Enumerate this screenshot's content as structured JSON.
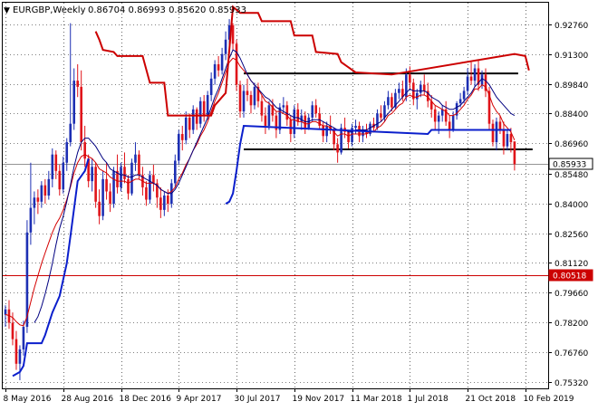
{
  "header": {
    "symbol": "EURGBP,Weekly",
    "ohlc": "0.86704 0.86993 0.85620 0.85933"
  },
  "price_badges": {
    "current": "0.85933",
    "level": "0.80518"
  },
  "colors": {
    "bull": "#1d2fb3",
    "bear": "#e0141a",
    "ma_fast": "#d40000",
    "ma_slow": "#000080",
    "stop_up": "#0b1fcc",
    "stop_down": "#cc0000",
    "hline": "#000000",
    "level": "#cc0000",
    "grid": "#000000",
    "frame": "#000000"
  },
  "chart_data": {
    "type": "candlestick",
    "title": "EURGBP,Weekly",
    "ylim": [
      0.75,
      0.938
    ],
    "y_ticks": [
      "0.92760",
      "0.91300",
      "0.89840",
      "0.88400",
      "0.86960",
      "0.85480",
      "0.84000",
      "0.82560",
      "0.81120",
      "0.79660",
      "0.78200",
      "0.76760",
      "0.75320"
    ],
    "x_ticks": [
      "8 May 2016",
      "28 Aug 2016",
      "18 Dec 2016",
      "9 Apr 2017",
      "30 Jul 2017",
      "19 Nov 2017",
      "11 Mar 2018",
      "1 Jul 2018",
      "21 Oct 2018",
      "10 Feb 2019"
    ],
    "x_tick_bar_index": [
      0,
      16,
      32,
      48,
      64,
      80,
      96,
      112,
      128,
      144
    ],
    "grid": true,
    "hlines": [
      {
        "value": 0.9035,
        "from_bar": 66,
        "to_bar": 142
      },
      {
        "value": 0.8665,
        "from_bar": 66,
        "to_bar": 146
      }
    ],
    "level_line": 0.80518,
    "current_price": 0.85933,
    "ohlc": [
      [
        0.7859,
        0.7905,
        0.78,
        0.7885
      ],
      [
        0.7885,
        0.793,
        0.779,
        0.782
      ],
      [
        0.782,
        0.787,
        0.771,
        0.774
      ],
      [
        0.774,
        0.778,
        0.759,
        0.762
      ],
      [
        0.762,
        0.771,
        0.754,
        0.769
      ],
      [
        0.769,
        0.783,
        0.766,
        0.78
      ],
      [
        0.78,
        0.832,
        0.777,
        0.826
      ],
      [
        0.826,
        0.86,
        0.82,
        0.838
      ],
      [
        0.838,
        0.846,
        0.83,
        0.843
      ],
      [
        0.843,
        0.847,
        0.835,
        0.841
      ],
      [
        0.841,
        0.851,
        0.838,
        0.849
      ],
      [
        0.849,
        0.852,
        0.84,
        0.844
      ],
      [
        0.844,
        0.856,
        0.842,
        0.852
      ],
      [
        0.852,
        0.867,
        0.848,
        0.864
      ],
      [
        0.864,
        0.866,
        0.852,
        0.856
      ],
      [
        0.856,
        0.859,
        0.844,
        0.847
      ],
      [
        0.847,
        0.863,
        0.845,
        0.86
      ],
      [
        0.86,
        0.872,
        0.856,
        0.87
      ],
      [
        0.87,
        0.928,
        0.868,
        0.879
      ],
      [
        0.879,
        0.906,
        0.876,
        0.9
      ],
      [
        0.9,
        0.908,
        0.892,
        0.897
      ],
      [
        0.897,
        0.905,
        0.866,
        0.87
      ],
      [
        0.87,
        0.878,
        0.858,
        0.862
      ],
      [
        0.862,
        0.864,
        0.848,
        0.851
      ],
      [
        0.851,
        0.862,
        0.846,
        0.858
      ],
      [
        0.858,
        0.86,
        0.838,
        0.841
      ],
      [
        0.841,
        0.847,
        0.83,
        0.834
      ],
      [
        0.834,
        0.856,
        0.832,
        0.852
      ],
      [
        0.852,
        0.86,
        0.842,
        0.846
      ],
      [
        0.846,
        0.85,
        0.836,
        0.84
      ],
      [
        0.84,
        0.858,
        0.838,
        0.856
      ],
      [
        0.856,
        0.864,
        0.845,
        0.848
      ],
      [
        0.848,
        0.86,
        0.846,
        0.858
      ],
      [
        0.858,
        0.865,
        0.85,
        0.852
      ],
      [
        0.852,
        0.854,
        0.842,
        0.845
      ],
      [
        0.845,
        0.862,
        0.844,
        0.86
      ],
      [
        0.86,
        0.87,
        0.856,
        0.864
      ],
      [
        0.864,
        0.866,
        0.852,
        0.854
      ],
      [
        0.854,
        0.858,
        0.844,
        0.848
      ],
      [
        0.848,
        0.851,
        0.839,
        0.842
      ],
      [
        0.842,
        0.856,
        0.84,
        0.854
      ],
      [
        0.854,
        0.859,
        0.846,
        0.85
      ],
      [
        0.85,
        0.852,
        0.838,
        0.843
      ],
      [
        0.843,
        0.848,
        0.833,
        0.837
      ],
      [
        0.837,
        0.846,
        0.834,
        0.844
      ],
      [
        0.844,
        0.847,
        0.836,
        0.84
      ],
      [
        0.84,
        0.852,
        0.838,
        0.85
      ],
      [
        0.85,
        0.864,
        0.848,
        0.861
      ],
      [
        0.861,
        0.876,
        0.859,
        0.874
      ],
      [
        0.874,
        0.878,
        0.866,
        0.871
      ],
      [
        0.871,
        0.885,
        0.869,
        0.882
      ],
      [
        0.882,
        0.884,
        0.872,
        0.876
      ],
      [
        0.876,
        0.888,
        0.874,
        0.886
      ],
      [
        0.886,
        0.887,
        0.876,
        0.879
      ],
      [
        0.879,
        0.892,
        0.877,
        0.89
      ],
      [
        0.89,
        0.893,
        0.88,
        0.883
      ],
      [
        0.883,
        0.895,
        0.881,
        0.893
      ],
      [
        0.893,
        0.904,
        0.89,
        0.901
      ],
      [
        0.901,
        0.91,
        0.898,
        0.908
      ],
      [
        0.908,
        0.912,
        0.902,
        0.905
      ],
      [
        0.905,
        0.916,
        0.903,
        0.913
      ],
      [
        0.913,
        0.924,
        0.91,
        0.92
      ],
      [
        0.92,
        0.93,
        0.915,
        0.927
      ],
      [
        0.927,
        0.928,
        0.915,
        0.918
      ],
      [
        0.918,
        0.92,
        0.895,
        0.898
      ],
      [
        0.898,
        0.9,
        0.882,
        0.885
      ],
      [
        0.885,
        0.898,
        0.882,
        0.895
      ],
      [
        0.895,
        0.901,
        0.89,
        0.893
      ],
      [
        0.893,
        0.895,
        0.884,
        0.888
      ],
      [
        0.888,
        0.899,
        0.886,
        0.897
      ],
      [
        0.897,
        0.899,
        0.887,
        0.89
      ],
      [
        0.89,
        0.893,
        0.88,
        0.883
      ],
      [
        0.883,
        0.887,
        0.874,
        0.878
      ],
      [
        0.878,
        0.89,
        0.876,
        0.888
      ],
      [
        0.888,
        0.891,
        0.88,
        0.883
      ],
      [
        0.883,
        0.885,
        0.872,
        0.876
      ],
      [
        0.876,
        0.889,
        0.874,
        0.887
      ],
      [
        0.887,
        0.892,
        0.884,
        0.888
      ],
      [
        0.888,
        0.89,
        0.878,
        0.881
      ],
      [
        0.881,
        0.883,
        0.87,
        0.874
      ],
      [
        0.874,
        0.888,
        0.872,
        0.886
      ],
      [
        0.886,
        0.889,
        0.878,
        0.88
      ],
      [
        0.88,
        0.886,
        0.876,
        0.883
      ],
      [
        0.883,
        0.885,
        0.874,
        0.877
      ],
      [
        0.877,
        0.884,
        0.876,
        0.882
      ],
      [
        0.882,
        0.89,
        0.88,
        0.888
      ],
      [
        0.888,
        0.891,
        0.882,
        0.884
      ],
      [
        0.884,
        0.887,
        0.876,
        0.878
      ],
      [
        0.878,
        0.88,
        0.87,
        0.873
      ],
      [
        0.873,
        0.88,
        0.87,
        0.878
      ],
      [
        0.878,
        0.883,
        0.874,
        0.876
      ],
      [
        0.876,
        0.877,
        0.866,
        0.869
      ],
      [
        0.869,
        0.872,
        0.86,
        0.865
      ],
      [
        0.865,
        0.879,
        0.864,
        0.877
      ],
      [
        0.877,
        0.882,
        0.872,
        0.875
      ],
      [
        0.875,
        0.876,
        0.867,
        0.87
      ],
      [
        0.87,
        0.879,
        0.868,
        0.877
      ],
      [
        0.877,
        0.881,
        0.874,
        0.878
      ],
      [
        0.878,
        0.88,
        0.87,
        0.873
      ],
      [
        0.873,
        0.878,
        0.87,
        0.876
      ],
      [
        0.876,
        0.879,
        0.872,
        0.874
      ],
      [
        0.874,
        0.88,
        0.873,
        0.879
      ],
      [
        0.879,
        0.882,
        0.875,
        0.877
      ],
      [
        0.877,
        0.886,
        0.876,
        0.884
      ],
      [
        0.884,
        0.888,
        0.88,
        0.882
      ],
      [
        0.882,
        0.89,
        0.88,
        0.888
      ],
      [
        0.888,
        0.895,
        0.886,
        0.892
      ],
      [
        0.892,
        0.894,
        0.885,
        0.887
      ],
      [
        0.887,
        0.896,
        0.886,
        0.894
      ],
      [
        0.894,
        0.899,
        0.891,
        0.896
      ],
      [
        0.896,
        0.9,
        0.89,
        0.892
      ],
      [
        0.892,
        0.906,
        0.89,
        0.903
      ],
      [
        0.903,
        0.907,
        0.896,
        0.899
      ],
      [
        0.899,
        0.901,
        0.888,
        0.891
      ],
      [
        0.891,
        0.896,
        0.886,
        0.894
      ],
      [
        0.894,
        0.9,
        0.892,
        0.898
      ],
      [
        0.898,
        0.903,
        0.893,
        0.895
      ],
      [
        0.895,
        0.899,
        0.887,
        0.89
      ],
      [
        0.89,
        0.893,
        0.882,
        0.886
      ],
      [
        0.886,
        0.888,
        0.876,
        0.88
      ],
      [
        0.88,
        0.885,
        0.874,
        0.883
      ],
      [
        0.883,
        0.888,
        0.88,
        0.886
      ],
      [
        0.886,
        0.89,
        0.878,
        0.88
      ],
      [
        0.88,
        0.883,
        0.872,
        0.876
      ],
      [
        0.876,
        0.885,
        0.875,
        0.883
      ],
      [
        0.883,
        0.89,
        0.881,
        0.889
      ],
      [
        0.889,
        0.894,
        0.887,
        0.891
      ],
      [
        0.891,
        0.897,
        0.889,
        0.895
      ],
      [
        0.895,
        0.906,
        0.893,
        0.902
      ],
      [
        0.902,
        0.909,
        0.898,
        0.9
      ],
      [
        0.9,
        0.908,
        0.897,
        0.906
      ],
      [
        0.906,
        0.91,
        0.895,
        0.898
      ],
      [
        0.898,
        0.905,
        0.896,
        0.903
      ],
      [
        0.903,
        0.906,
        0.892,
        0.895
      ],
      [
        0.895,
        0.897,
        0.876,
        0.879
      ],
      [
        0.879,
        0.881,
        0.868,
        0.87
      ],
      [
        0.87,
        0.882,
        0.866,
        0.88
      ],
      [
        0.88,
        0.883,
        0.874,
        0.876
      ],
      [
        0.876,
        0.88,
        0.864,
        0.868
      ],
      [
        0.868,
        0.876,
        0.866,
        0.874
      ],
      [
        0.874,
        0.877,
        0.865,
        0.87
      ],
      [
        0.8704,
        0.8699,
        0.8562,
        0.8593
      ]
    ],
    "ma_fast": [
      0.786,
      0.7855,
      0.7845,
      0.7825,
      0.781,
      0.7805,
      0.785,
      0.792,
      0.799,
      0.805,
      0.811,
      0.816,
      0.821,
      0.826,
      0.83,
      0.833,
      0.837,
      0.842,
      0.848,
      0.855,
      0.86,
      0.863,
      0.864,
      0.863,
      0.862,
      0.86,
      0.857,
      0.856,
      0.855,
      0.853,
      0.852,
      0.851,
      0.851,
      0.851,
      0.85,
      0.851,
      0.852,
      0.852,
      0.851,
      0.85,
      0.85,
      0.85,
      0.849,
      0.847,
      0.846,
      0.845,
      0.846,
      0.848,
      0.852,
      0.855,
      0.859,
      0.862,
      0.866,
      0.869,
      0.873,
      0.876,
      0.88,
      0.885,
      0.89,
      0.894,
      0.899,
      0.904,
      0.909,
      0.911,
      0.91,
      0.907,
      0.905,
      0.903,
      0.9,
      0.898,
      0.896,
      0.893,
      0.89,
      0.889,
      0.887,
      0.885,
      0.885,
      0.884,
      0.883,
      0.881,
      0.881,
      0.88,
      0.88,
      0.879,
      0.879,
      0.88,
      0.88,
      0.879,
      0.878,
      0.878,
      0.877,
      0.875,
      0.873,
      0.874,
      0.874,
      0.873,
      0.874,
      0.874,
      0.874,
      0.874,
      0.874,
      0.875,
      0.875,
      0.877,
      0.878,
      0.88,
      0.883,
      0.884,
      0.886,
      0.888,
      0.889,
      0.892,
      0.893,
      0.892,
      0.892,
      0.893,
      0.893,
      0.892,
      0.89,
      0.888,
      0.887,
      0.886,
      0.885,
      0.883,
      0.883,
      0.884,
      0.886,
      0.888,
      0.891,
      0.893,
      0.896,
      0.896,
      0.898,
      0.897,
      0.893,
      0.888,
      0.885,
      0.883,
      0.879,
      0.877,
      0.875,
      0.871
    ],
    "ma_slow": [
      null,
      null,
      null,
      null,
      null,
      null,
      null,
      null,
      0.782,
      0.785,
      0.79,
      0.796,
      0.803,
      0.811,
      0.82,
      0.828,
      0.834,
      0.841,
      0.849,
      0.858,
      0.865,
      0.87,
      0.872,
      0.872,
      0.87,
      0.868,
      0.865,
      0.862,
      0.86,
      0.857,
      0.856,
      0.855,
      0.854,
      0.854,
      0.853,
      0.853,
      0.854,
      0.854,
      0.853,
      0.852,
      0.851,
      0.85,
      0.849,
      0.847,
      0.846,
      0.845,
      0.845,
      0.847,
      0.85,
      0.854,
      0.858,
      0.862,
      0.866,
      0.87,
      0.874,
      0.878,
      0.882,
      0.887,
      0.892,
      0.896,
      0.901,
      0.906,
      0.911,
      0.915,
      0.914,
      0.911,
      0.907,
      0.903,
      0.9,
      0.898,
      0.896,
      0.894,
      0.892,
      0.891,
      0.889,
      0.887,
      0.886,
      0.885,
      0.884,
      0.883,
      0.882,
      0.882,
      0.881,
      0.88,
      0.88,
      0.881,
      0.881,
      0.881,
      0.88,
      0.879,
      0.878,
      0.877,
      0.876,
      0.876,
      0.876,
      0.875,
      0.875,
      0.876,
      0.876,
      0.876,
      0.876,
      0.877,
      0.878,
      0.879,
      0.88,
      0.882,
      0.884,
      0.886,
      0.888,
      0.89,
      0.892,
      0.894,
      0.896,
      0.895,
      0.895,
      0.895,
      0.895,
      0.894,
      0.892,
      0.891,
      0.89,
      0.888,
      0.887,
      0.886,
      0.886,
      0.887,
      0.888,
      0.89,
      0.892,
      0.894,
      0.897,
      0.899,
      0.901,
      0.9,
      0.898,
      0.895,
      0.892,
      0.89,
      0.888,
      0.886,
      0.884,
      0.883
    ],
    "stop_up": [
      [
        2,
        0.756
      ],
      [
        4,
        0.758
      ],
      [
        5,
        0.761
      ],
      [
        6,
        0.772
      ],
      [
        10,
        0.772
      ],
      [
        11,
        0.776
      ],
      [
        13,
        0.787
      ],
      [
        15,
        0.795
      ],
      [
        17,
        0.811
      ],
      [
        18,
        0.824
      ],
      [
        20,
        0.851
      ],
      [
        22,
        0.856
      ],
      [
        23,
        0.862
      ],
      [
        61,
        0.84
      ],
      [
        62,
        0.841
      ],
      [
        63,
        0.845
      ],
      [
        64,
        0.856
      ],
      [
        65,
        0.869
      ],
      [
        66,
        0.878
      ],
      [
        117,
        0.874
      ],
      [
        118,
        0.876
      ],
      [
        140,
        0.876
      ]
    ],
    "stop_down": [
      [
        25,
        0.924
      ],
      [
        26,
        0.92
      ],
      [
        27,
        0.915
      ],
      [
        30,
        0.914
      ],
      [
        31,
        0.912
      ],
      [
        38,
        0.912
      ],
      [
        40,
        0.899
      ],
      [
        44,
        0.899
      ],
      [
        45,
        0.883
      ],
      [
        57,
        0.883
      ],
      [
        58,
        0.888
      ],
      [
        59,
        0.89
      ],
      [
        60,
        0.892
      ],
      [
        61,
        0.894
      ],
      [
        63,
        0.936
      ],
      [
        65,
        0.933
      ],
      [
        70,
        0.933
      ],
      [
        71,
        0.929
      ],
      [
        79,
        0.929
      ],
      [
        80,
        0.922
      ],
      [
        85,
        0.922
      ],
      [
        86,
        0.914
      ],
      [
        92,
        0.913
      ],
      [
        93,
        0.909
      ],
      [
        97,
        0.904
      ],
      [
        107,
        0.903
      ],
      [
        141,
        0.913
      ],
      [
        144,
        0.912
      ],
      [
        145,
        0.905
      ]
    ]
  }
}
